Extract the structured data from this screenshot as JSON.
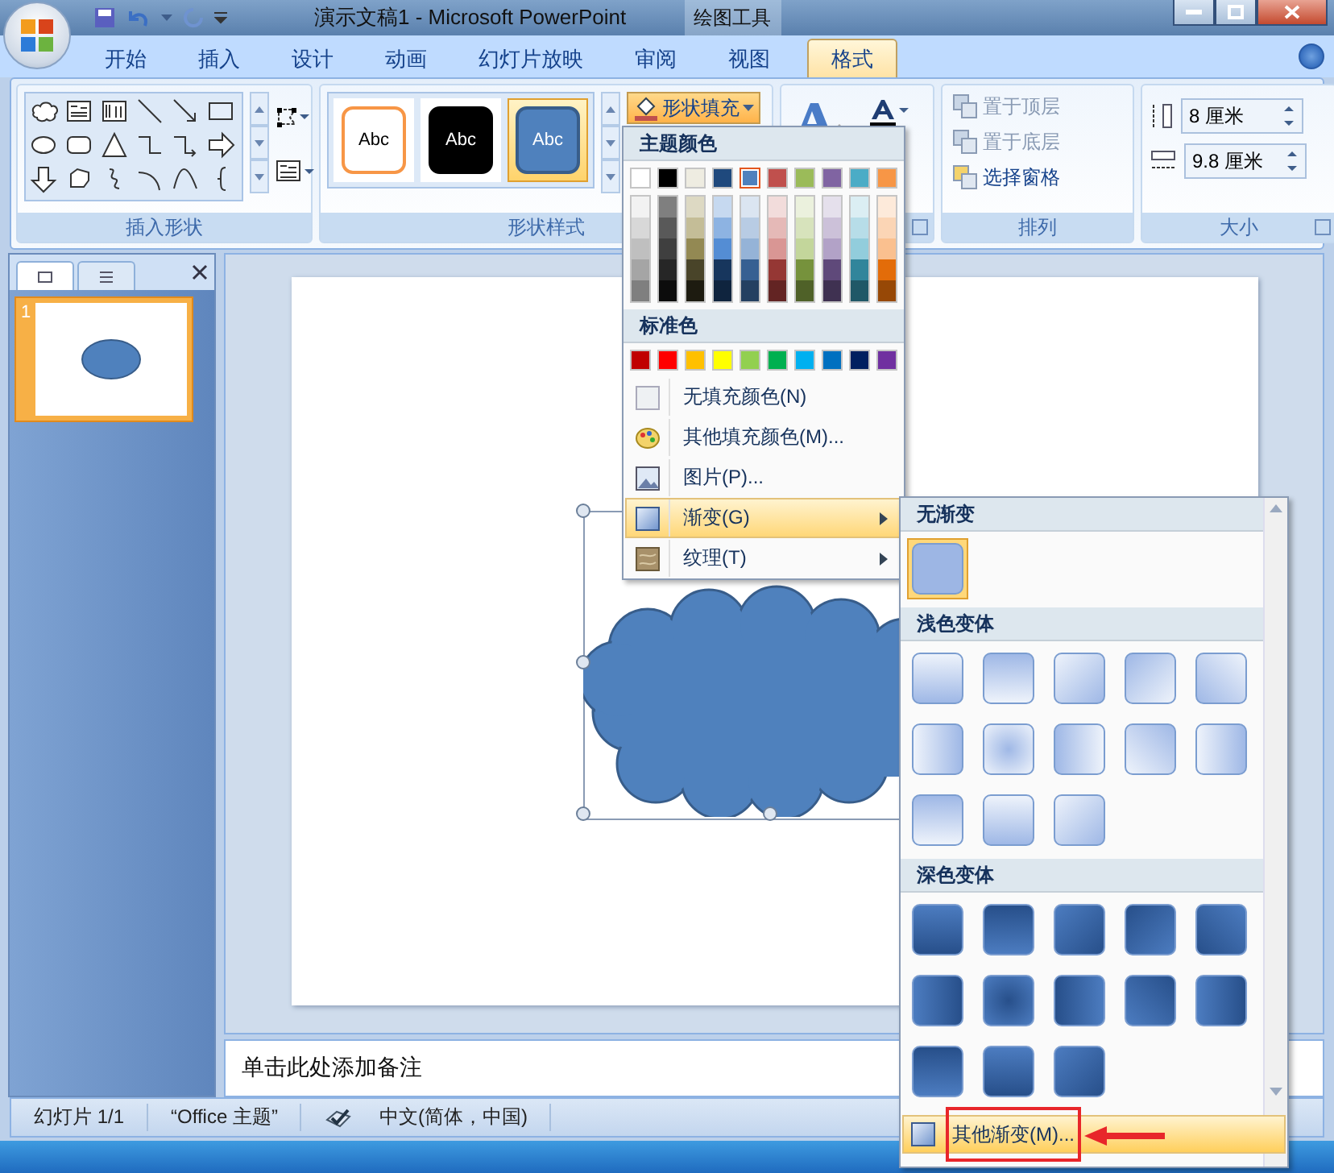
{
  "window": {
    "title": "演示文稿1 - Microsoft PowerPoint",
    "context_label": "绘图工具"
  },
  "tabs": [
    {
      "label": "开始",
      "selected": false
    },
    {
      "label": "插入",
      "selected": false
    },
    {
      "label": "设计",
      "selected": false
    },
    {
      "label": "动画",
      "selected": false
    },
    {
      "label": "幻灯片放映",
      "selected": false
    },
    {
      "label": "审阅",
      "selected": false
    },
    {
      "label": "视图",
      "selected": false
    },
    {
      "label": "格式",
      "selected": true
    }
  ],
  "ribbon": {
    "insert_shapes": {
      "label": "插入形状"
    },
    "shape_styles": {
      "label": "形状样式",
      "styles": [
        {
          "label": "Abc",
          "kind": "outline",
          "selected": false
        },
        {
          "label": "Abc",
          "kind": "dark",
          "selected": false
        },
        {
          "label": "Abc",
          "kind": "accent",
          "selected": true
        }
      ],
      "fill_button": {
        "label": "形状填充",
        "selected": true
      }
    },
    "arrange": {
      "label": "排列",
      "buttons": [
        {
          "label": "置于顶层",
          "disabled": true
        },
        {
          "label": "置于底层",
          "disabled": true
        },
        {
          "label": "选择窗格",
          "disabled": false
        }
      ]
    },
    "size": {
      "label": "大小",
      "fields": [
        {
          "kind": "height",
          "value": "8 厘米"
        },
        {
          "kind": "width",
          "value": "9.8 厘米"
        }
      ]
    }
  },
  "slides_pane": {
    "thumbnails": [
      {
        "number": "1",
        "selected": true
      }
    ]
  },
  "notes": {
    "placeholder": "单击此处添加备注"
  },
  "status_bar": [
    "幻灯片 1/1",
    "“Office 主题”",
    "中文(简体，中国)"
  ],
  "color_menu": {
    "theme_title": "主题颜色",
    "theme_colors": [
      {
        "color": "#ffffff",
        "selected": false,
        "shades": [
          {
            "color": "#f2f2f2"
          },
          {
            "color": "#d8d8d8"
          },
          {
            "color": "#bfbfbf"
          },
          {
            "color": "#a5a5a5"
          },
          {
            "color": "#7f7f7f"
          }
        ]
      },
      {
        "color": "#000000",
        "selected": false,
        "shades": [
          {
            "color": "#7f7f7f"
          },
          {
            "color": "#595959"
          },
          {
            "color": "#3f3f3f"
          },
          {
            "color": "#262626"
          },
          {
            "color": "#0c0c0c"
          }
        ]
      },
      {
        "color": "#eeece1",
        "selected": false,
        "shades": [
          {
            "color": "#ddd9c3"
          },
          {
            "color": "#c4bd97"
          },
          {
            "color": "#938953"
          },
          {
            "color": "#494429"
          },
          {
            "color": "#1d1b10"
          }
        ]
      },
      {
        "color": "#1f497d",
        "selected": false,
        "shades": [
          {
            "color": "#c6d9f0"
          },
          {
            "color": "#8db3e2"
          },
          {
            "color": "#548dd4"
          },
          {
            "color": "#17365d"
          },
          {
            "color": "#0f243e"
          }
        ]
      },
      {
        "color": "#4f81bd",
        "selected": true,
        "shades": [
          {
            "color": "#dbe5f1"
          },
          {
            "color": "#b8cce4"
          },
          {
            "color": "#95b3d7"
          },
          {
            "color": "#366092"
          },
          {
            "color": "#244061"
          }
        ]
      },
      {
        "color": "#c0504d",
        "selected": false,
        "shades": [
          {
            "color": "#f2dcdb"
          },
          {
            "color": "#e5b9b7"
          },
          {
            "color": "#d99694"
          },
          {
            "color": "#953734"
          },
          {
            "color": "#632423"
          }
        ]
      },
      {
        "color": "#9bbb59",
        "selected": false,
        "shades": [
          {
            "color": "#ebf1dd"
          },
          {
            "color": "#d7e3bc"
          },
          {
            "color": "#c3d69b"
          },
          {
            "color": "#76923c"
          },
          {
            "color": "#4f6128"
          }
        ]
      },
      {
        "color": "#8064a2",
        "selected": false,
        "shades": [
          {
            "color": "#e5e0ec"
          },
          {
            "color": "#ccc1d9"
          },
          {
            "color": "#b2a2c7"
          },
          {
            "color": "#5f497a"
          },
          {
            "color": "#3f3151"
          }
        ]
      },
      {
        "color": "#4bacc6",
        "selected": false,
        "shades": [
          {
            "color": "#dbeef3"
          },
          {
            "color": "#b7dde8"
          },
          {
            "color": "#92cddc"
          },
          {
            "color": "#31859b"
          },
          {
            "color": "#205867"
          }
        ]
      },
      {
        "color": "#f79646",
        "selected": false,
        "shades": [
          {
            "color": "#fdeada"
          },
          {
            "color": "#fbd5b5"
          },
          {
            "color": "#fac08f"
          },
          {
            "color": "#e36c09"
          },
          {
            "color": "#974806"
          }
        ]
      }
    ],
    "standard_title": "标准色",
    "standard_colors": [
      {
        "color": "#c00000"
      },
      {
        "color": "#ff0000"
      },
      {
        "color": "#ffc000"
      },
      {
        "color": "#ffff00"
      },
      {
        "color": "#92d050"
      },
      {
        "color": "#00b050"
      },
      {
        "color": "#00b0f0"
      },
      {
        "color": "#0070c0"
      },
      {
        "color": "#002060"
      },
      {
        "color": "#7030a0"
      }
    ],
    "items": [
      {
        "label": "无填充颜色(N)",
        "kind": "no-fill",
        "selected": false,
        "submenu": false
      },
      {
        "label": "其他填充颜色(M)...",
        "kind": "palette",
        "selected": false,
        "submenu": false
      },
      {
        "label": "图片(P)...",
        "kind": "picture",
        "selected": false,
        "submenu": false
      },
      {
        "label": "渐变(G)",
        "kind": "gradient",
        "selected": true,
        "submenu": true
      },
      {
        "label": "纹理(T)",
        "kind": "texture",
        "selected": false,
        "submenu": true
      }
    ]
  },
  "gradient_menu": {
    "sections": [
      {
        "title": "无渐变",
        "kind": "none",
        "items": [
          {
            "selected": true
          }
        ]
      },
      {
        "title": "浅色变体",
        "kind": "light",
        "items": [
          {
            "selected": false
          },
          {
            "selected": false
          },
          {
            "selected": false
          },
          {
            "selected": false
          },
          {
            "selected": false
          },
          {
            "selected": false
          },
          {
            "selected": false
          },
          {
            "selected": false
          },
          {
            "selected": false
          },
          {
            "selected": false
          },
          {
            "selected": false
          },
          {
            "selected": false
          },
          {
            "selected": false
          }
        ]
      },
      {
        "title": "深色变体",
        "kind": "dark",
        "items": [
          {
            "selected": false
          },
          {
            "selected": false
          },
          {
            "selected": false
          },
          {
            "selected": false
          },
          {
            "selected": false
          },
          {
            "selected": false
          },
          {
            "selected": false
          },
          {
            "selected": false
          },
          {
            "selected": false
          },
          {
            "selected": false
          },
          {
            "selected": false
          },
          {
            "selected": false
          },
          {
            "selected": false
          }
        ]
      }
    ],
    "footer": {
      "label": "其他渐变(M)...",
      "selected": true
    }
  }
}
